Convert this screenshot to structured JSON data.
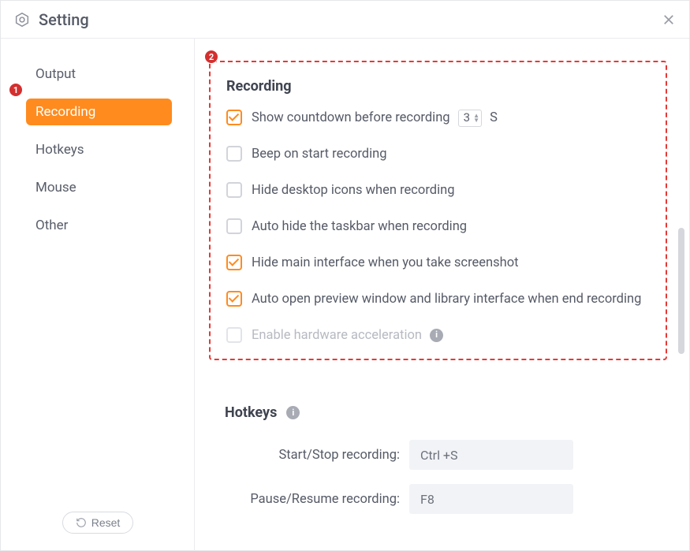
{
  "title": "Setting",
  "sidebar": {
    "items": [
      {
        "label": "Output",
        "active": false
      },
      {
        "label": "Recording",
        "active": true
      },
      {
        "label": "Hotkeys",
        "active": false
      },
      {
        "label": "Mouse",
        "active": false
      },
      {
        "label": "Other",
        "active": false
      }
    ]
  },
  "reset_label": "Reset",
  "annotations": {
    "badge1": "1",
    "badge2": "2"
  },
  "recording": {
    "title": "Recording",
    "countdown_label": "Show countdown before recording",
    "countdown_value": "3",
    "countdown_unit": "S",
    "options": [
      {
        "label": "Beep on start recording",
        "checked": false,
        "disabled": false
      },
      {
        "label": "Hide desktop icons when recording",
        "checked": false,
        "disabled": false
      },
      {
        "label": "Auto hide the taskbar when recording",
        "checked": false,
        "disabled": false
      },
      {
        "label": "Hide main interface when you take screenshot",
        "checked": true,
        "disabled": false
      },
      {
        "label": "Auto open preview window and library interface when end recording",
        "checked": true,
        "disabled": false
      },
      {
        "label": "Enable hardware acceleration",
        "checked": false,
        "disabled": true,
        "info": true
      }
    ]
  },
  "hotkeys": {
    "title": "Hotkeys",
    "rows": [
      {
        "label": "Start/Stop recording:",
        "value": "Ctrl +S"
      },
      {
        "label": "Pause/Resume recording:",
        "value": "F8"
      }
    ]
  }
}
